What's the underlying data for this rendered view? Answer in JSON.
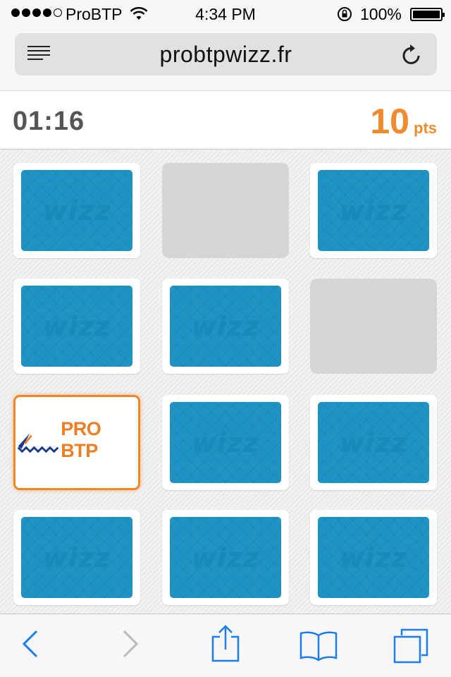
{
  "status_bar": {
    "carrier": "ProBTP",
    "time": "4:34 PM",
    "battery": "100%"
  },
  "browser": {
    "url": "probtpwizz.fr",
    "icons": [
      "menu-icon",
      "reload-icon",
      "back-icon",
      "forward-icon",
      "share-icon",
      "bookmarks-icon",
      "tabs-icon"
    ]
  },
  "game": {
    "timer": "01:16",
    "score_value": "10",
    "score_unit": "pts",
    "card_back_label": "wizz",
    "revealed_card_label": "PRO BTP",
    "grid": {
      "rows": 4,
      "cols": 3,
      "cells": [
        "back",
        "matched",
        "back",
        "back",
        "back",
        "matched",
        "revealed",
        "back",
        "back",
        "back",
        "back",
        "back"
      ]
    }
  },
  "colors": {
    "accent": "#f08a2e",
    "card_blue": "#1f93c4",
    "matched_gray": "#d6d6d6",
    "ios_blue": "#1a7cf0"
  }
}
